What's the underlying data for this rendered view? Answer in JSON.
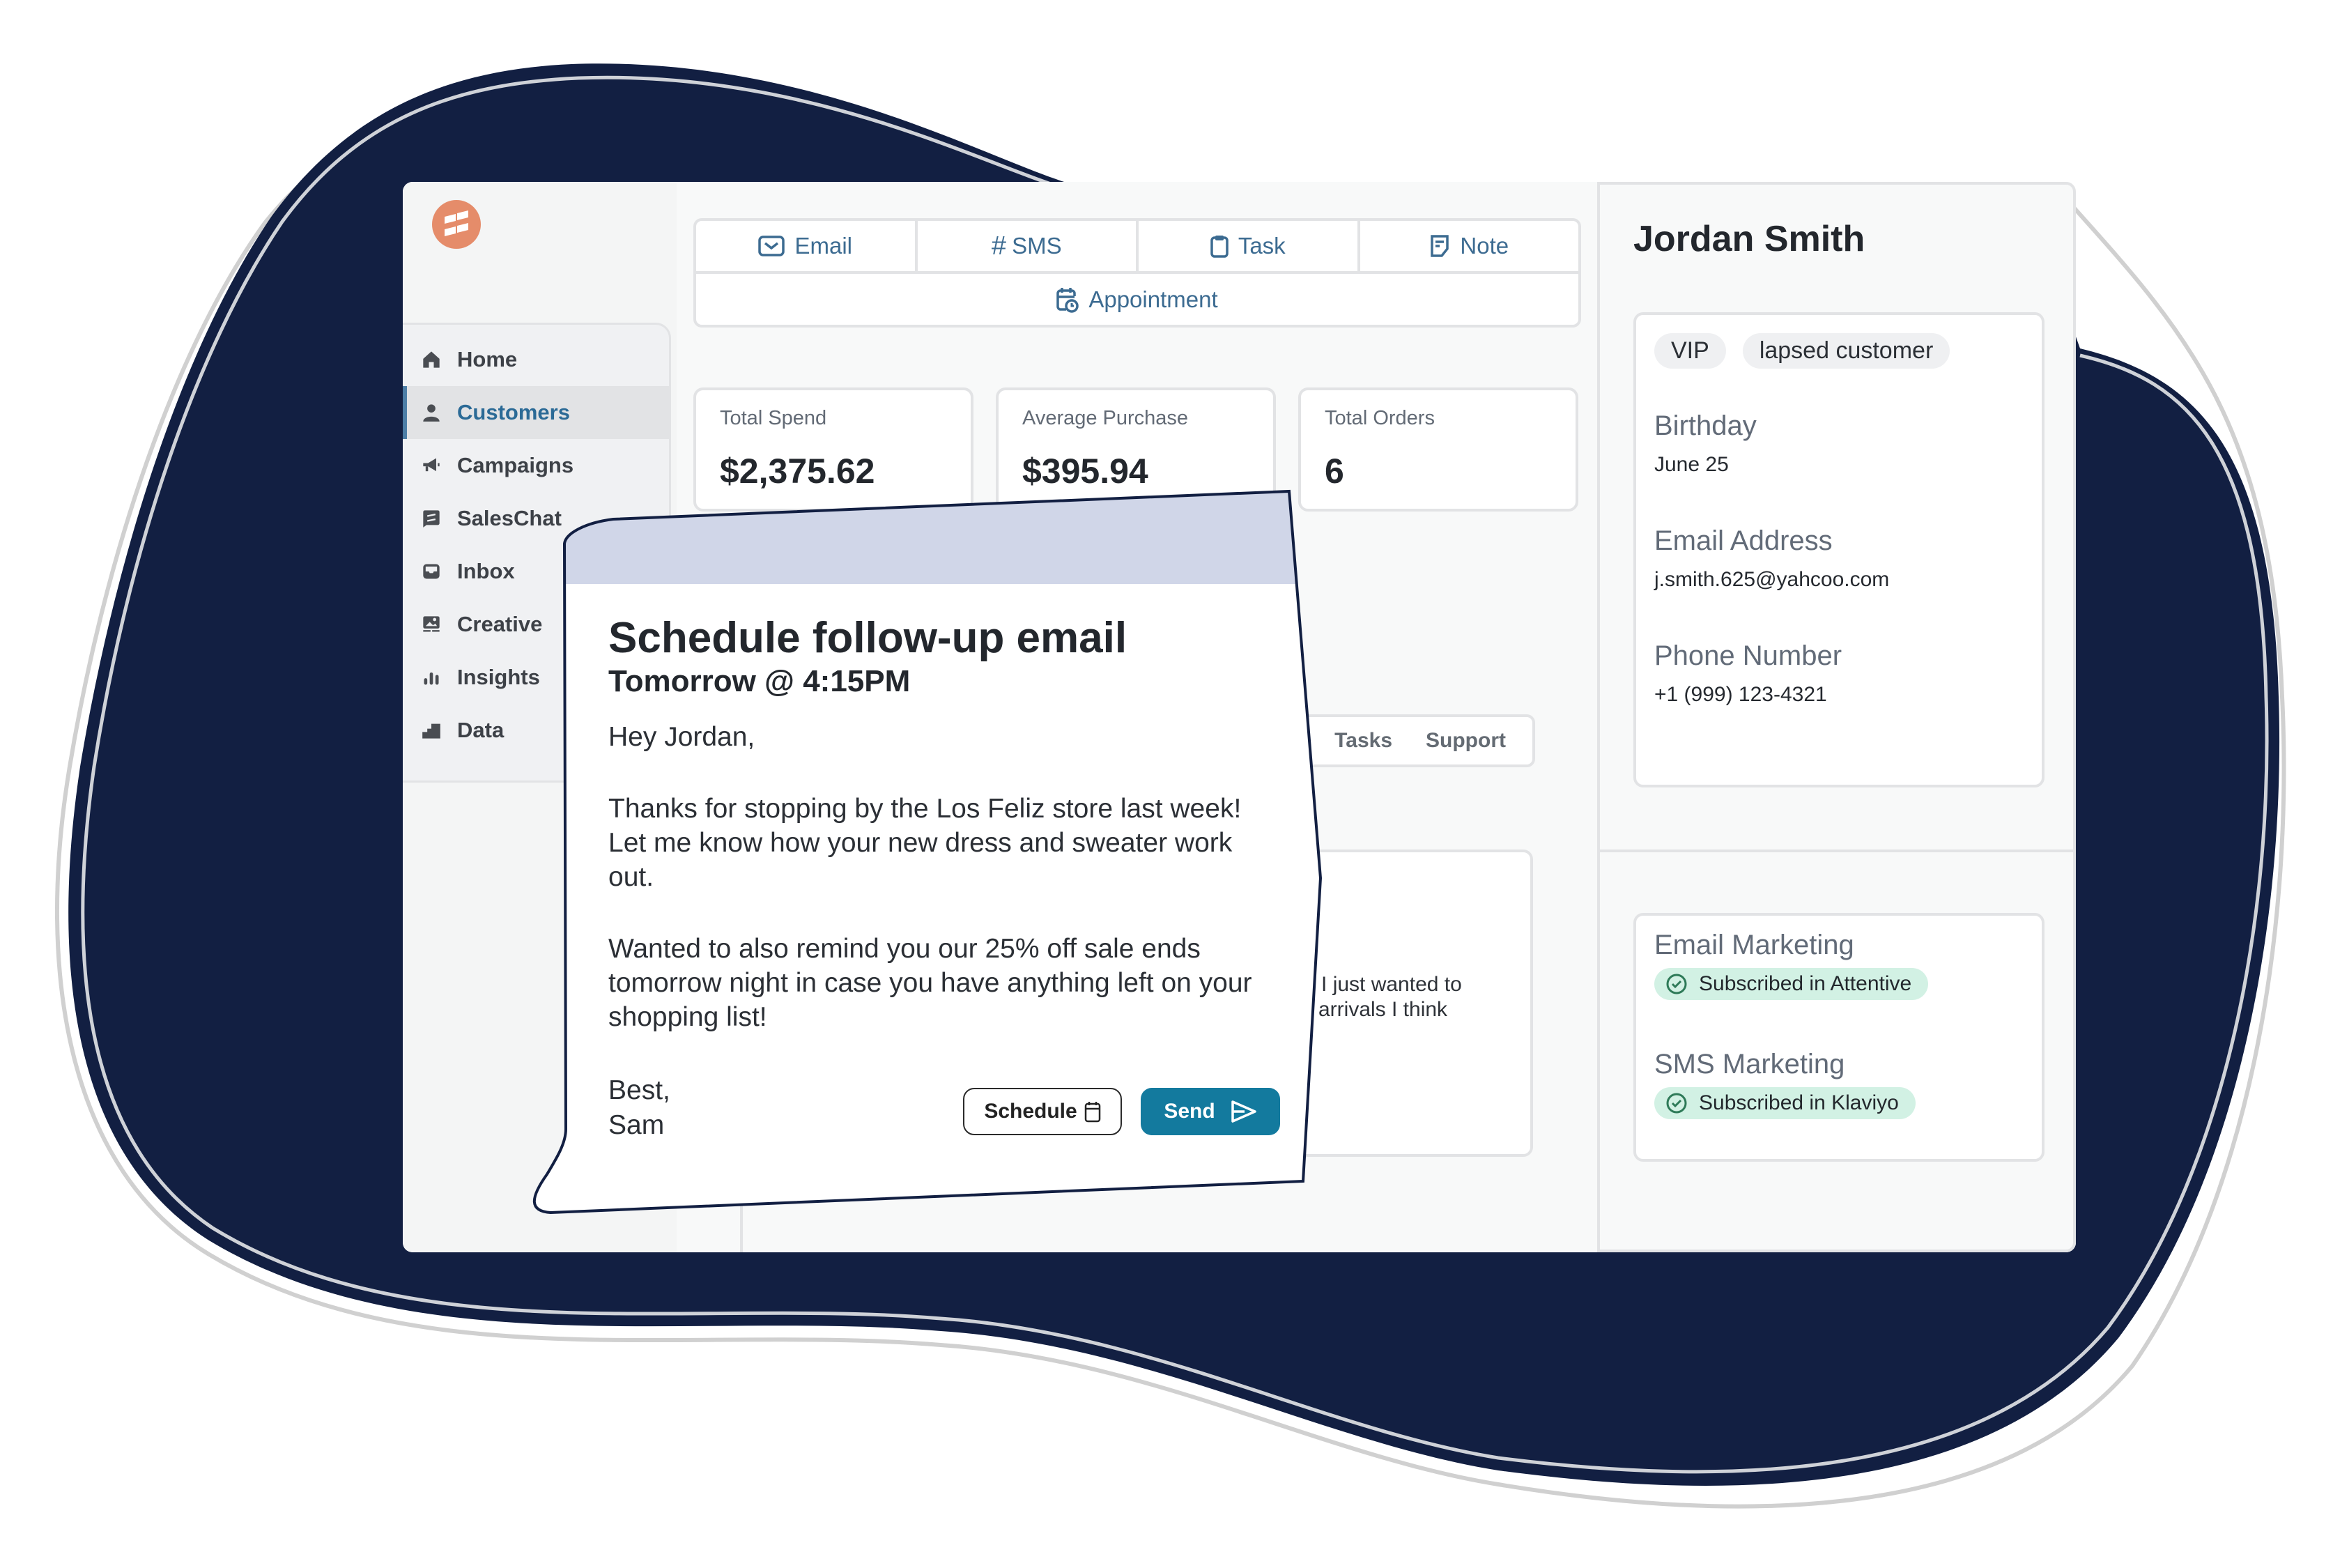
{
  "colors": {
    "blob": "#121f42",
    "accent": "#137a9e",
    "logo": "#e58c6a",
    "nav_active": "#2b6a96",
    "modal_header": "#d0d6e8",
    "badge_bg": "#d2f1e4",
    "badge_icon": "#2e7a58"
  },
  "sidebar": {
    "logo_icon": "brand-logo-icon",
    "items": [
      {
        "label": "Home",
        "icon": "home-icon",
        "active": false
      },
      {
        "label": "Customers",
        "icon": "user-icon",
        "active": true
      },
      {
        "label": "Campaigns",
        "icon": "megaphone-icon",
        "active": false
      },
      {
        "label": "SalesChat",
        "icon": "chat-icon",
        "active": false
      },
      {
        "label": "Inbox",
        "icon": "inbox-icon",
        "active": false
      },
      {
        "label": "Creative",
        "icon": "image-icon",
        "active": false
      },
      {
        "label": "Insights",
        "icon": "bar-chart-icon",
        "active": false
      },
      {
        "label": "Data",
        "icon": "data-icon",
        "active": false
      }
    ]
  },
  "actions": {
    "email": "Email",
    "sms": "SMS",
    "task": "Task",
    "note": "Note",
    "appointment": "Appointment"
  },
  "stats": [
    {
      "label": "Total Spend",
      "value": "$2,375.62"
    },
    {
      "label": "Average Purchase",
      "value": "$395.94"
    },
    {
      "label": "Total Orders",
      "value": "6"
    }
  ],
  "tabs": [
    "Tasks",
    "Support"
  ],
  "note_preview": {
    "line1": "so I just wanted to",
    "line2": "w arrivals I think"
  },
  "profile": {
    "name": "Jordan Smith",
    "tags": [
      "VIP",
      "lapsed customer"
    ],
    "fields": [
      {
        "label": "Birthday",
        "value": "June 25"
      },
      {
        "label": "Email Address",
        "value": "j.smith.625@yahcoo.com"
      },
      {
        "label": "Phone Number",
        "value": "+1 (999) 123-4321"
      }
    ],
    "marketing": [
      {
        "label": "Email Marketing",
        "status": "Subscribed in Attentive"
      },
      {
        "label": "SMS Marketing",
        "status": "Subscribed in Klaviyo"
      }
    ]
  },
  "modal": {
    "title": "Schedule follow-up email",
    "subtitle": "Tomorrow @ 4:15PM",
    "greeting": "Hey Jordan,",
    "paragraph1": "Thanks for stopping by the Los Feliz store last week! Let me know how your new dress and sweater work out.",
    "paragraph2": "Wanted to also remind you our 25% off sale ends tomorrow night in case you have anything left on your shopping list!",
    "signoff": "Best,",
    "signature": "Sam",
    "schedule_label": "Schedule",
    "send_label": "Send"
  }
}
